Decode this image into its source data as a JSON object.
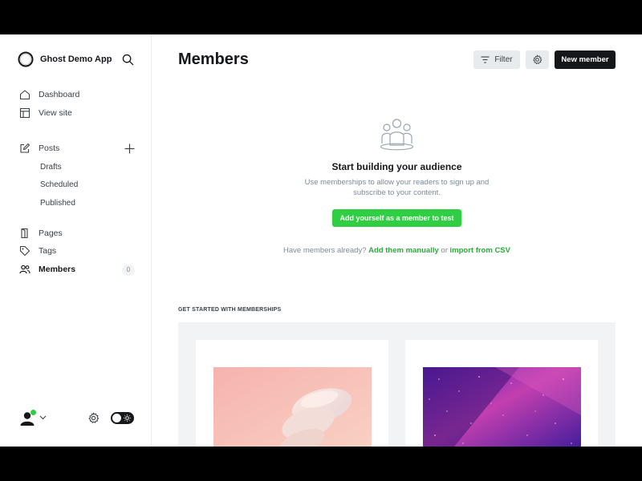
{
  "sidebar": {
    "brand_title": "Ghost Demo App",
    "nav": {
      "dashboard": "Dashboard",
      "view_site": "View site",
      "posts": "Posts",
      "drafts": "Drafts",
      "scheduled": "Scheduled",
      "published": "Published",
      "pages": "Pages",
      "tags": "Tags",
      "members": "Members",
      "members_count": "0"
    }
  },
  "header": {
    "title": "Members",
    "filter_label": "Filter",
    "new_member_label": "New member"
  },
  "empty_state": {
    "title": "Start building your audience",
    "description": "Use memberships to allow your readers to sign up and subscribe to your content.",
    "cta_label": "Add yourself as a member to test",
    "have_members_text": "Have members already?",
    "add_manually_label": "Add them manually",
    "or_text": "or",
    "import_csv_label": "import from CSV"
  },
  "get_started": {
    "section_label": "GET STARTED WITH MEMBERSHIPS"
  },
  "colors": {
    "accent_green": "#30cf43",
    "dark": "#15171a",
    "muted": "#7c8b9a"
  }
}
